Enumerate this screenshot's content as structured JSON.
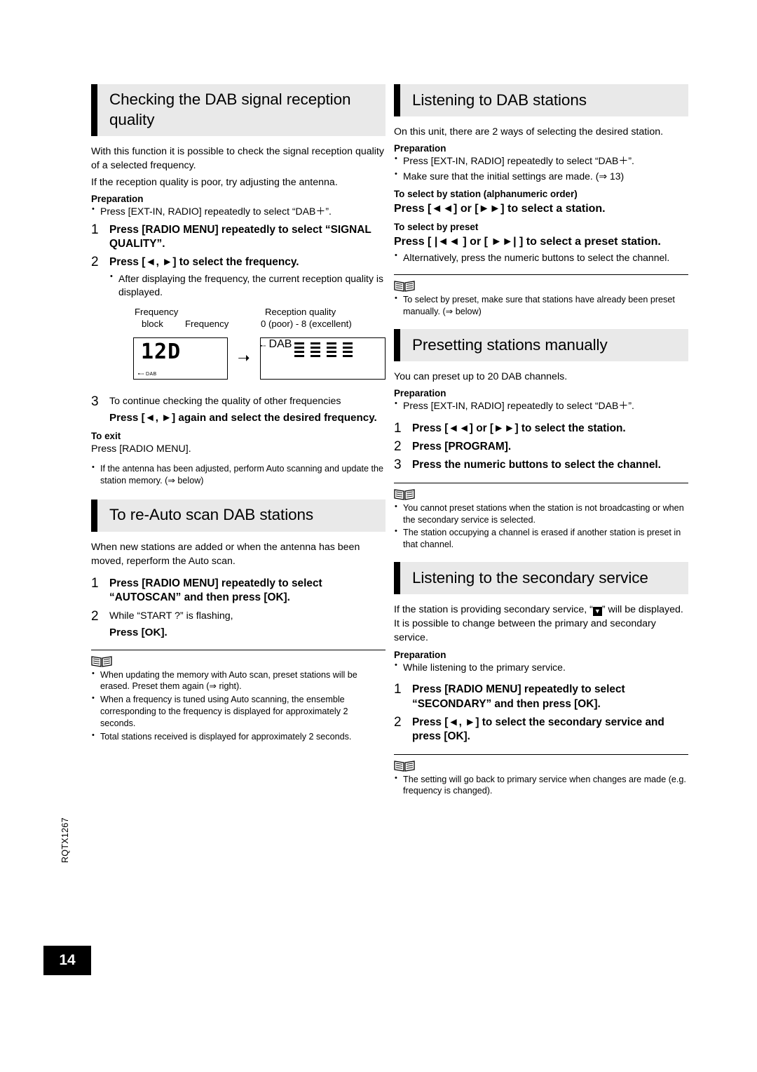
{
  "page": {
    "number": "14",
    "side_code": "RQTX1267"
  },
  "left": {
    "sec1": {
      "title": "Checking the DAB signal reception quality",
      "intro1": "With this function it is possible to check the signal reception quality of a selected frequency.",
      "intro2": "If the reception quality is poor, try adjusting the antenna.",
      "prep_label": "Preparation",
      "prep_item": "Press [EXT-IN, RADIO] repeatedly to select “DAB＋”.",
      "step1_num": "1",
      "step1_text": "Press [RADIO MENU] repeatedly to select “SIGNAL QUALITY”.",
      "step2_num": "2",
      "step2_text": "Press [◄, ►] to select the frequency.",
      "step2_bullet": "After displaying the frequency, the current reception quality is displayed.",
      "fig_label_freq_block_1": "Frequency",
      "fig_label_freq_block_2": "block",
      "fig_label_freq": "Frequency",
      "fig_label_quality_1": "Reception quality",
      "fig_label_quality_2": "0 (poor) - 8 (excellent)",
      "lcd1_value": "12D",
      "lcd1_tiny": "DAB",
      "lcd2_tiny": "DAB",
      "step3_num": "3",
      "step3_text": "To continue checking the quality of other frequencies",
      "step3_bold": "Press [◄, ►] again and select the desired frequency.",
      "exit_label": "To exit",
      "exit_text": "Press [RADIO MENU].",
      "note_bullet": "If the antenna has been adjusted, perform Auto scanning and update the station memory. (⇒ below)"
    },
    "sec2": {
      "title": "To re-Auto scan DAB stations",
      "intro": "When new stations are added or when the antenna has been moved, reperform the Auto scan.",
      "step1_num": "1",
      "step1_text": "Press [RADIO MENU] repeatedly to select “AUTOSCAN” and then press [OK].",
      "step2_num": "2",
      "step2_text": "While “START ?” is flashing,",
      "step2_bold": "Press [OK].",
      "notes": [
        "When updating the memory with Auto scan, preset stations will be erased. Preset them again (⇒ right).",
        "When a frequency is tuned using Auto scanning, the ensemble corresponding to the frequency is displayed for approximately 2 seconds.",
        "Total stations received is displayed for approximately 2 seconds."
      ]
    }
  },
  "right": {
    "sec1": {
      "title": "Listening to DAB stations",
      "intro": "On this unit, there are 2 ways of selecting the desired station.",
      "prep_label": "Preparation",
      "prep_items": [
        "Press [EXT-IN, RADIO] repeatedly to select “DAB＋”.",
        "Make sure that the initial settings are made. (⇒ 13)"
      ],
      "sub1_label": "To select by station (alphanumeric order)",
      "sub1_bold": "Press [◄◄] or [►►] to select a station.",
      "sub2_label": "To select by preset",
      "sub2_bold": "Press [ |◄◄ ] or [ ►►| ] to select a preset station.",
      "sub2_bullet": "Alternatively, press the numeric buttons to select the channel.",
      "note": "To select by preset, make sure that stations have already been preset manually. (⇒ below)"
    },
    "sec2": {
      "title": "Presetting stations manually",
      "intro": "You can preset up to 20 DAB channels.",
      "prep_label": "Preparation",
      "prep_item": "Press [EXT-IN, RADIO] repeatedly to select “DAB＋”.",
      "step1_num": "1",
      "step1_text": "Press [◄◄] or [►►] to select the station.",
      "step2_num": "2",
      "step2_text": "Press [PROGRAM].",
      "step3_num": "3",
      "step3_text": "Press the numeric buttons to select the channel.",
      "notes": [
        "You cannot preset stations when the station is not broadcasting or when the secondary service is selected.",
        "The station occupying a channel is erased if another station is preset in that channel."
      ]
    },
    "sec3": {
      "title": "Listening to the secondary service",
      "intro_a": "If the station is providing secondary service, “",
      "intro_icon": "▼",
      "intro_b": "” will be displayed. It is possible to change between the primary and secondary service.",
      "prep_label": "Preparation",
      "prep_item": "While listening to the primary service.",
      "step1_num": "1",
      "step1_text": "Press [RADIO MENU] repeatedly to select “SECONDARY” and then press [OK].",
      "step2_num": "2",
      "step2_text": "Press [◄, ►] to select the secondary service and press [OK].",
      "notes": [
        "The setting will go back to primary service when changes are made (e.g. frequency is changed)."
      ]
    }
  }
}
